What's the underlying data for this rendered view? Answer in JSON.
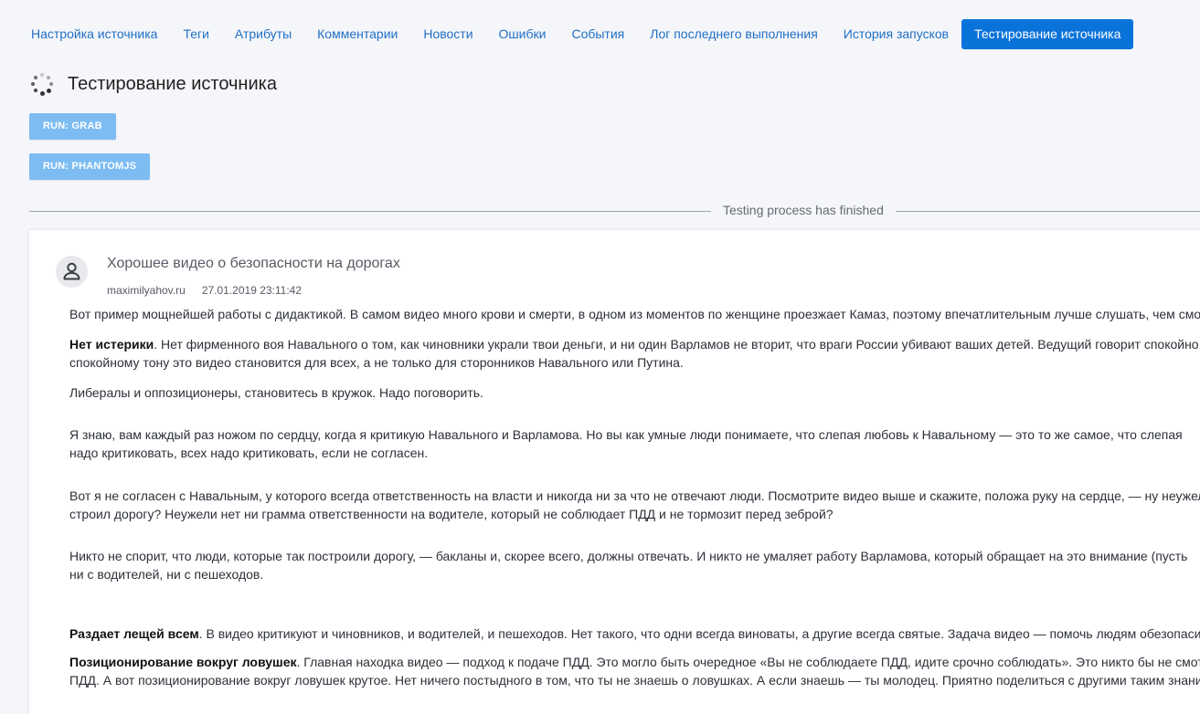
{
  "tabs": [
    {
      "label": "Настройка источника"
    },
    {
      "label": "Теги"
    },
    {
      "label": "Атрибуты"
    },
    {
      "label": "Комментарии"
    },
    {
      "label": "Новости"
    },
    {
      "label": "Ошибки"
    },
    {
      "label": "События"
    },
    {
      "label": "Лог последнего выполнения"
    },
    {
      "label": "История запусков"
    },
    {
      "label": "Тестирование источника"
    }
  ],
  "page": {
    "title": "Тестирование источника",
    "run_grab": "RUN: GRAB",
    "run_phantomjs": "RUN: PHANTOMJS",
    "status": "Testing process has finished"
  },
  "item": {
    "title": "Хорошее видео о безопасности на дорогах",
    "source": "maximilyahov.ru",
    "date": "27.01.2019 23:11:42",
    "p1": "Вот пример мощнейшей работы с дидактикой. В самом видео много крови и смерти, в одном из моментов по женщине проезжает Камаз, поэтому впечатлительным лучше слушать, чем смотреть.",
    "p2_bold": "Нет истерики",
    "p2_line1": ". Нет фирменного воя Навального о том, как чиновники украли твои деньги, и ни один Варламов не вторит, что враги России убивают ваших детей. Ведущий говорит спокойно.",
    "p2_line2": "спокойному тону это видео становится для всех, а не только для сторонников Навального или Путина.",
    "p3": "Либералы и оппозиционеры, становитесь в кружок. Надо поговорить.",
    "p4_line1": "Я знаю, вам каждый раз ножом по сердцу, когда я критикую Навального и Варламова. Но вы как умные люди понимаете, что слепая любовь к Навальному — это то же самое, что слепая",
    "p4_line2": "надо критиковать, всех надо критиковать, если не согласен.",
    "p5_line1": "Вот я не согласен с Навальным, у которого всегда ответственность на власти и никогда ни за что не отвечают люди. Посмотрите видео выше и скажите, положа руку на сердце, — ну неужели",
    "p5_line2": "строил дорогу? Неужели нет ни грамма ответственности на водителе, который не соблюдает ПДД и не тормозит перед зеброй?",
    "p6_line1": "Никто не спорит, что люди, которые так построили дорогу, — бакланы и, скорее всего, должны отвечать. И никто не умаляет работу Варламова, который обращает на это внимание (пусть",
    "p6_line2": "ни с водителей, ни с пешеходов.",
    "p7_bold": "Раздает лещей всем",
    "p7_rest": ". В видео критикуют и чиновников, и водителей, и пешеходов. Нет такого, что одни всегда виноваты, а другие всегда святые. Задача видео — помочь людям обезопасить себя.",
    "p8_bold": "Позиционирование вокруг ловушек",
    "p8_line1": ". Главная находка видео — подход к подаче ПДД. Это могло быть очередное «Вы не соблюдаете ПДД, идите срочно соблюдать». Это никто бы не смотрел.",
    "p8_line2": "ПДД. А вот позиционирование вокруг ловушек крутое. Нет ничего постыдного в том, что ты не знаешь о ловушках. А если знаешь — ты молодец. Приятно поделиться с другими таким знанием."
  },
  "colors": {
    "accent": "#0a73d9",
    "link": "#1f6fc5",
    "run_button": "#7cbcf2",
    "background": "#f5f6fa"
  }
}
